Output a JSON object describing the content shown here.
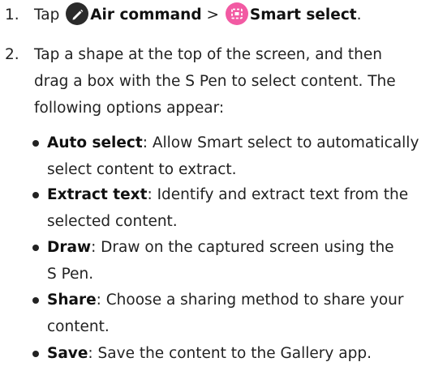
{
  "steps": [
    {
      "number": "1.",
      "prefix": "Tap",
      "air_command": "Air command",
      "separator": ">",
      "smart_select": "Smart select",
      "suffix": "."
    },
    {
      "number": "2.",
      "line1": "Tap a shape at the top of the screen, and then",
      "line2": "drag a box with the S Pen to select content. The",
      "line3": "following options appear:"
    }
  ],
  "options": [
    {
      "term": "Auto select",
      "line1": ": Allow Smart select to automatically",
      "line2": "select content to extract."
    },
    {
      "term": "Extract text",
      "line1": ": Identify and extract text from the",
      "line2": "selected content."
    },
    {
      "term": "Draw",
      "line1": ": Draw on the captured screen using the",
      "line2": "S Pen."
    },
    {
      "term": "Share",
      "line1": ": Choose a sharing method to share your",
      "line2": "content."
    },
    {
      "term": "Save",
      "line1": ": Save the content to the Gallery app.",
      "line2": ""
    }
  ],
  "colors": {
    "air_command_icon": "#2b2b2b",
    "smart_select_icon": "#f25aa3"
  },
  "icons": [
    "pen-icon",
    "smart-select-icon"
  ]
}
